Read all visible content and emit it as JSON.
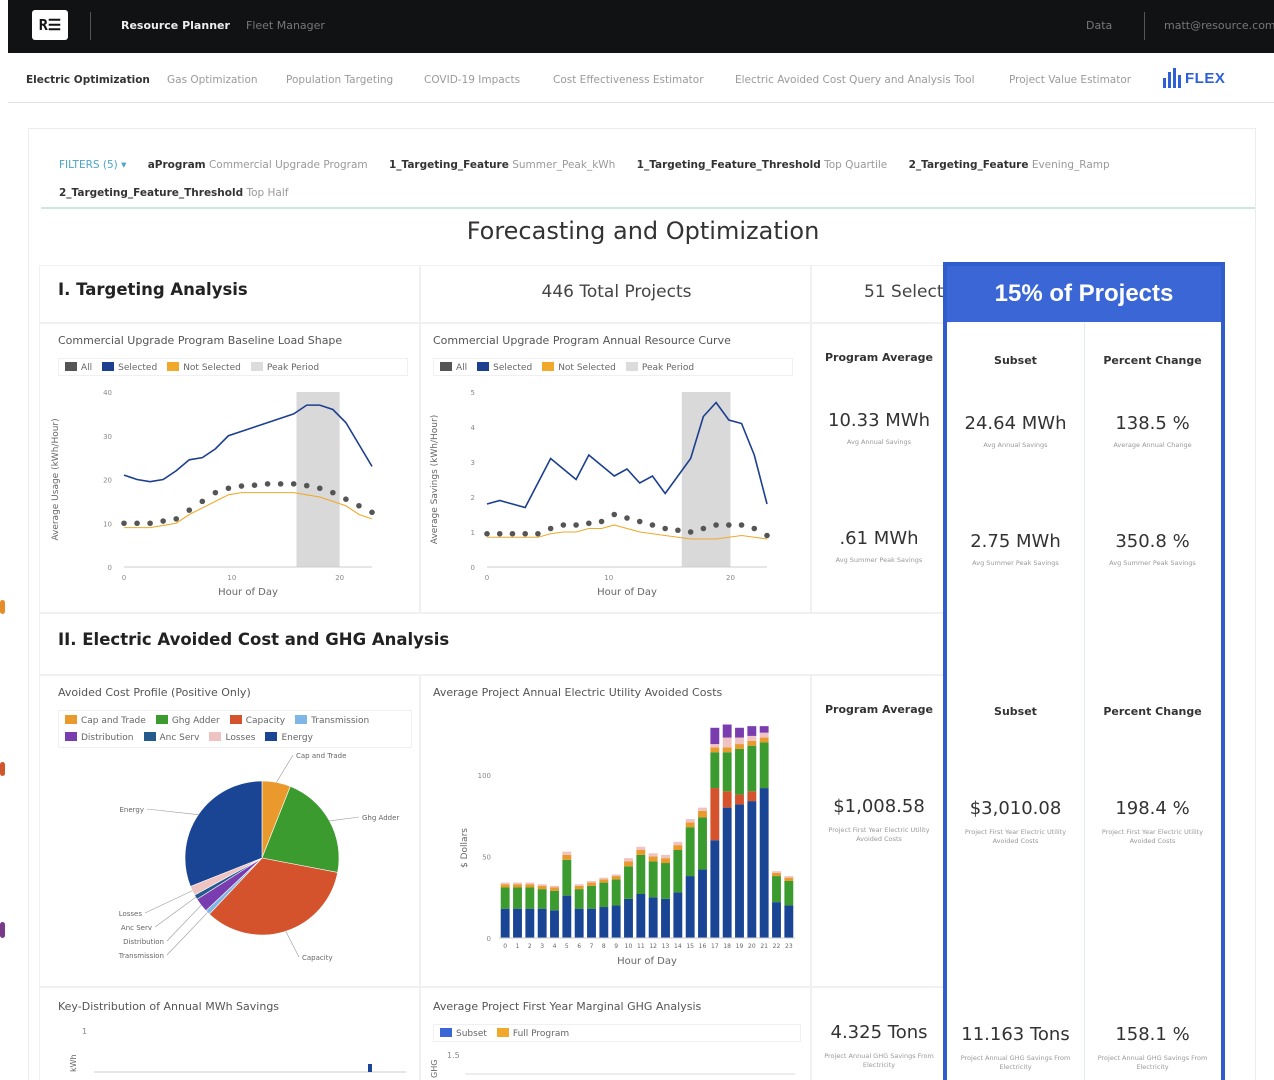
{
  "topbar": {
    "logo": "R☰",
    "nav": [
      "Resource Planner",
      "Fleet Manager"
    ],
    "active": "Resource Planner",
    "right_link": "Data",
    "user_email": "matt@resource.com"
  },
  "subnav": {
    "tabs": [
      "Electric Optimization",
      "Gas Optimization",
      "Population Targeting",
      "COVID-19 Impacts",
      "Cost Effectiveness Estimator",
      "Electric Avoided Cost Query and Analysis Tool",
      "Project Value Estimator"
    ],
    "active": "Electric Optimization",
    "brand": "FLEX"
  },
  "filters": {
    "label": "FILTERS (5) ▾",
    "items": [
      {
        "key": "aProgram",
        "value": "Commercial Upgrade Program"
      },
      {
        "key": "1_Targeting_Feature",
        "value": "Summer_Peak_kWh"
      },
      {
        "key": "1_Targeting_Feature_Threshold",
        "value": "Top Quartile"
      },
      {
        "key": "2_Targeting_Feature",
        "value": "Evening_Ramp"
      },
      {
        "key": "2_Targeting_Feature_Threshold",
        "value": "Top Half"
      }
    ]
  },
  "dashboard": {
    "title": "Forecasting and Optimization",
    "section1": "I. Targeting Analysis",
    "total_projects": "446 Total Projects",
    "selected_projects": "51 Selecte",
    "highlight": "15% of Projects",
    "section2": "II. Electric Avoided Cost and GHG Analysis"
  },
  "kpi_tables": {
    "headers": [
      "Program Average",
      "Subset",
      "Percent Change"
    ],
    "rows": [
      {
        "values": [
          "10.33 MWh",
          "24.64 MWh",
          "138.5 %"
        ],
        "subs": [
          "Avg Annual Savings",
          "Avg Annual Savings",
          "Average Annual Change"
        ]
      },
      {
        "values": [
          ".61 MWh",
          "2.75 MWh",
          "350.8 %"
        ],
        "subs": [
          "Avg Summer Peak Savings",
          "Avg Summer Peak Savings",
          "Avg Summer Peak Savings"
        ]
      },
      {
        "values": [
          "$1,008.58",
          "$3,010.08",
          "198.4 %"
        ],
        "subs": [
          "Project First Year Electric Utility Avoided Costs",
          "Project First Year Electric Utility Avoided Costs",
          "Project First Year Electric Utility Avoided Costs"
        ]
      },
      {
        "values": [
          "4.325 Tons",
          "11.163 Tons",
          "158.1 %"
        ],
        "subs": [
          "Project Annual GHG Savings From Electricity",
          "Project Annual GHG Savings From Electricity",
          "Project Annual GHG Savings From Electricity"
        ]
      }
    ]
  },
  "colors": {
    "all": "#555555",
    "selected": "#1c3f8f",
    "not_selected": "#f0a92b",
    "peak": "#d9d9d9",
    "cap_trade": "#ea9a2d",
    "ghg_adder": "#3b9b2f",
    "capacity": "#d4532c",
    "transmission": "#7fb6e8",
    "distribution": "#7a3db0",
    "anc_serv": "#245a8c",
    "losses": "#f0c3c3",
    "energy": "#1a4494",
    "highlight": "#3b67d6"
  },
  "chart_data": [
    {
      "type": "line",
      "title": "Commercial Upgrade Program Baseline Load Shape",
      "xlabel": "Hour of Day",
      "ylabel": "Average Usage (kWh/Hour)",
      "legend": [
        "All",
        "Selected",
        "Not Selected",
        "Peak Period"
      ],
      "x": [
        0,
        1,
        2,
        3,
        4,
        5,
        6,
        7,
        8,
        9,
        10,
        11,
        12,
        13,
        14,
        15,
        16,
        17,
        18,
        19,
        20,
        21,
        22,
        23
      ],
      "xticks": [
        "0",
        "10",
        "20"
      ],
      "yticks": [
        "0",
        "10",
        "20",
        "30",
        "40"
      ],
      "ylim": [
        0,
        40
      ],
      "peak_period": [
        16,
        20
      ],
      "series": [
        {
          "name": "Selected",
          "values": [
            21,
            20,
            19.5,
            20,
            22,
            24.5,
            25,
            27,
            30,
            31,
            32,
            33,
            34,
            35,
            37,
            37,
            36,
            33,
            28,
            23
          ]
        },
        {
          "name": "All",
          "values": [
            10,
            10,
            10,
            10.5,
            11,
            13,
            15,
            17,
            18,
            18.5,
            18.7,
            19,
            19,
            19,
            18.6,
            18,
            17,
            15.5,
            14,
            12.5
          ]
        },
        {
          "name": "Not Selected",
          "values": [
            9,
            9,
            9,
            9.5,
            10,
            12,
            13.5,
            15,
            16.5,
            17,
            17,
            17,
            17,
            17,
            16.5,
            16,
            15,
            14,
            12,
            11
          ]
        }
      ]
    },
    {
      "type": "line",
      "title": "Commercial Upgrade Program Annual Resource Curve",
      "xlabel": "Hour of Day",
      "ylabel": "Average Savings (kWh/Hour)",
      "legend": [
        "All",
        "Selected",
        "Not Selected",
        "Peak Period"
      ],
      "x": [
        0,
        1,
        2,
        3,
        4,
        5,
        6,
        7,
        8,
        9,
        10,
        11,
        12,
        13,
        14,
        15,
        16,
        17,
        18,
        19,
        20,
        21,
        22,
        23
      ],
      "xticks": [
        "0",
        "10",
        "20"
      ],
      "yticks": [
        "0",
        "1",
        "2",
        "3",
        "4",
        "5"
      ],
      "ylim": [
        0,
        5
      ],
      "peak_period": [
        16,
        20
      ],
      "series": [
        {
          "name": "Selected",
          "values": [
            1.8,
            1.9,
            1.8,
            1.7,
            2.4,
            3.1,
            2.8,
            2.5,
            3.2,
            2.9,
            2.6,
            2.8,
            2.4,
            2.6,
            2.1,
            2.6,
            3.1,
            4.3,
            4.7,
            4.2,
            4.1,
            3.2,
            1.8
          ]
        },
        {
          "name": "All",
          "values": [
            0.95,
            0.95,
            0.95,
            0.95,
            0.95,
            1.1,
            1.2,
            1.2,
            1.25,
            1.3,
            1.5,
            1.4,
            1.3,
            1.2,
            1.1,
            1.05,
            1.0,
            1.1,
            1.2,
            1.2,
            1.2,
            1.1,
            0.9
          ]
        },
        {
          "name": "Not Selected",
          "values": [
            0.85,
            0.85,
            0.85,
            0.85,
            0.85,
            0.95,
            1.0,
            1.0,
            1.1,
            1.1,
            1.2,
            1.1,
            1.0,
            0.95,
            0.9,
            0.85,
            0.8,
            0.8,
            0.8,
            0.85,
            0.9,
            0.85,
            0.8
          ]
        }
      ]
    },
    {
      "type": "pie",
      "title": "Avoided Cost Profile (Positive Only)",
      "legend": [
        "Cap and Trade",
        "Ghg Adder",
        "Capacity",
        "Transmission",
        "Distribution",
        "Anc Serv",
        "Losses",
        "Energy"
      ],
      "labels": [
        "Cap and Trade",
        "Ghg Adder",
        "Capacity",
        "Transmission",
        "Distribution",
        "Anc Serv",
        "Losses",
        "Energy"
      ],
      "values": [
        6,
        22,
        34,
        1,
        3,
        1,
        2,
        31
      ]
    },
    {
      "type": "bar",
      "title": "Average Project Annual Electric Utility Avoided Costs",
      "xlabel": "Hour of Day",
      "ylabel": "$ Dollars",
      "categories": [
        "0",
        "1",
        "2",
        "3",
        "4",
        "5",
        "6",
        "7",
        "8",
        "9",
        "10",
        "11",
        "12",
        "13",
        "14",
        "15",
        "16",
        "17",
        "18",
        "19",
        "20",
        "21",
        "22",
        "23"
      ],
      "yticks": [
        "0",
        "50",
        "100"
      ],
      "ylim": [
        0,
        135
      ],
      "series": [
        {
          "name": "Energy",
          "values": [
            18,
            18,
            18,
            18,
            17,
            26,
            18,
            18,
            19,
            20,
            24,
            27,
            25,
            24,
            28,
            38,
            42,
            60,
            80,
            82,
            84,
            92,
            22,
            20
          ]
        },
        {
          "name": "Capacity",
          "values": [
            0,
            0,
            0,
            0,
            0,
            0,
            0,
            0,
            0,
            0,
            0,
            0,
            0,
            0,
            0,
            0,
            0,
            32,
            10,
            6,
            6,
            0,
            0,
            0
          ]
        },
        {
          "name": "Ghg Adder",
          "values": [
            13,
            13,
            13,
            12,
            12,
            22,
            12,
            14,
            15,
            16,
            20,
            24,
            22,
            22,
            26,
            30,
            32,
            22,
            24,
            28,
            28,
            28,
            16,
            15
          ]
        },
        {
          "name": "Cap and Trade",
          "values": [
            2,
            2,
            2,
            2,
            2,
            3,
            2,
            2,
            2,
            2,
            3,
            3,
            3,
            3,
            3,
            3,
            4,
            3,
            3,
            3,
            3,
            3,
            2,
            2
          ]
        },
        {
          "name": "Losses",
          "values": [
            1,
            1,
            1,
            1,
            1,
            2,
            1,
            1,
            1,
            1,
            2,
            2,
            2,
            2,
            2,
            2,
            2,
            2,
            6,
            4,
            3,
            3,
            1,
            1
          ]
        },
        {
          "name": "Distribution",
          "values": [
            0,
            0,
            0,
            0,
            0,
            0,
            0,
            0,
            0,
            0,
            0,
            0,
            0,
            0,
            0,
            0,
            0,
            10,
            8,
            6,
            6,
            4,
            0,
            0
          ]
        }
      ]
    },
    {
      "type": "bar",
      "title": "Key-Distribution of Annual MWh Savings",
      "values": []
    },
    {
      "type": "line",
      "title": "Average Project First Year Marginal GHG Analysis",
      "legend": [
        "Subset",
        "Full Program"
      ],
      "yticks": [
        "1.5"
      ]
    }
  ]
}
